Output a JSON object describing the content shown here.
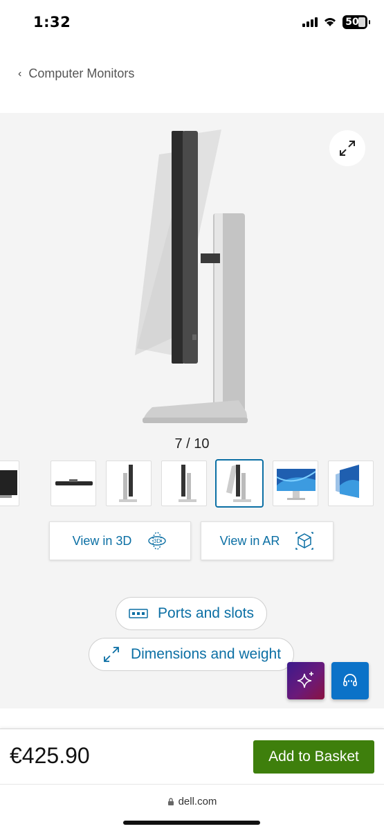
{
  "status_bar": {
    "time": "1:32",
    "battery_level": "50"
  },
  "breadcrumb": {
    "label": "Computer Monitors"
  },
  "gallery": {
    "counter": "7 / 10",
    "current_index": 7,
    "total": 10,
    "expand_icon": "expand-arrows-icon",
    "thumbnails": [
      "monitor-front-dark",
      "monitor-flat-top",
      "monitor-side-left",
      "monitor-side-right",
      "monitor-side-tilt",
      "monitor-front-wallpaper",
      "monitor-angle-wallpaper"
    ]
  },
  "view_buttons": {
    "view_3d": "View in 3D",
    "badge_3d": "3D",
    "view_ar": "View in AR"
  },
  "feature_links": {
    "ports": "Ports and slots",
    "dimensions": "Dimensions and weight"
  },
  "purchase": {
    "price": "€425.90",
    "add_to_basket": "Add to Basket"
  },
  "browser": {
    "url": "dell.com"
  },
  "colors": {
    "accent_blue": "#0b6fa4",
    "add_button_green": "#3e7f0c",
    "support_fab": "#0b72c8"
  }
}
